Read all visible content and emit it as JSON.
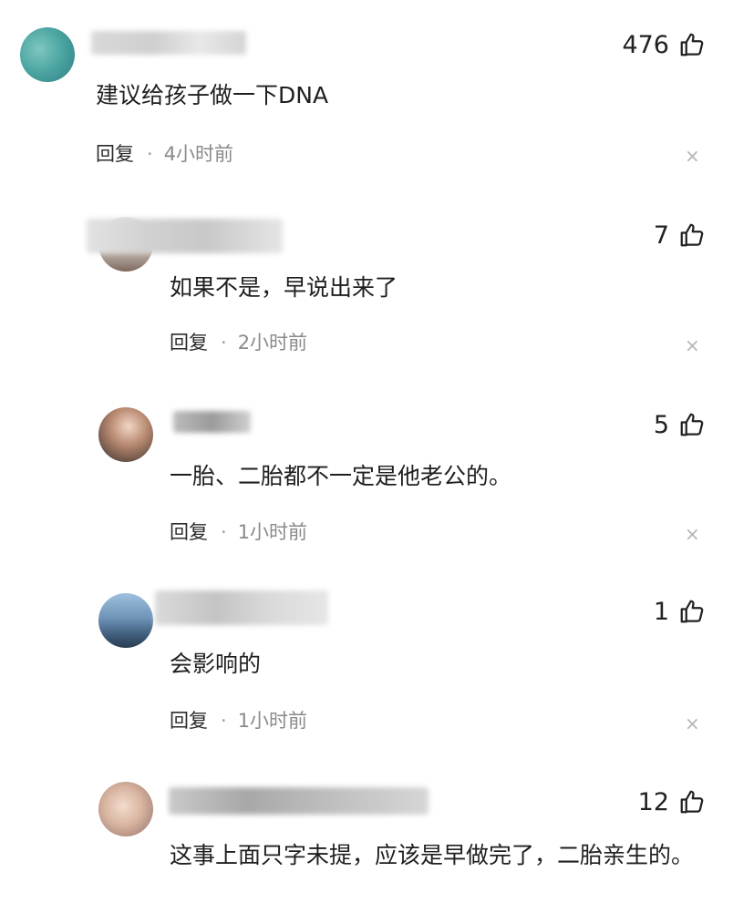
{
  "comments": [
    {
      "likes": "476",
      "text": "建议给孩子做一下DNA",
      "reply_label": "回复",
      "separator": "·",
      "time": "4小时前",
      "close": "×"
    },
    {
      "likes": "7",
      "text": "如果不是，早说出来了",
      "reply_label": "回复",
      "separator": "·",
      "time": "2小时前",
      "close": "×"
    },
    {
      "likes": "5",
      "text": "一胎、二胎都不一定是他老公的。",
      "reply_label": "回复",
      "separator": "·",
      "time": "1小时前",
      "close": "×"
    },
    {
      "likes": "1",
      "text": "会影响的",
      "reply_label": "回复",
      "separator": "·",
      "time": "1小时前",
      "close": "×"
    },
    {
      "likes": "12",
      "text": "这事上面只字未提，应该是早做完了，二胎亲生的。"
    }
  ],
  "icons": {
    "like": "thumbs-up-icon",
    "close": "close-icon"
  },
  "colors": {
    "text": "#1f1f1f",
    "meta_time": "#8a8a8a",
    "close": "#b5b5b5"
  }
}
